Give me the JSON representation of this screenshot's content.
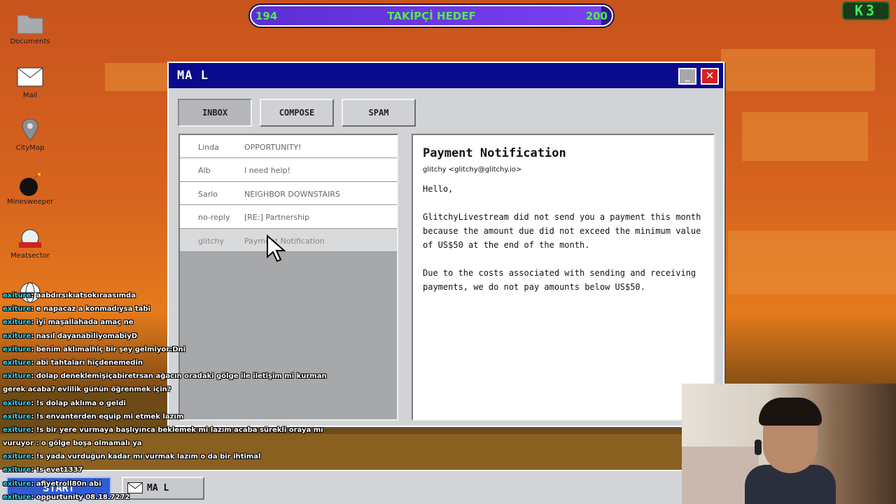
{
  "goal_bar": {
    "current": "194",
    "label": "TAKİPÇİ HEDEF",
    "target": "200",
    "progress": 0.97
  },
  "corner_badge": "K3",
  "desktop_icons": [
    {
      "label": "Documents",
      "icon": "folder-icon"
    },
    {
      "label": "Mail",
      "icon": "envelope-icon"
    },
    {
      "label": "CityMap",
      "icon": "map-pin-icon"
    },
    {
      "label": "Minesweeper",
      "icon": "bomb-icon"
    },
    {
      "label": "Meatsector",
      "icon": "meat-slicer-icon"
    },
    {
      "label": "",
      "icon": "globe-icon"
    }
  ],
  "window": {
    "title": "MA L",
    "minimize": "_",
    "close": "✕"
  },
  "tabs": [
    {
      "label": "INBOX",
      "active": true
    },
    {
      "label": "COMPOSE",
      "active": false
    },
    {
      "label": "SPAM",
      "active": false
    }
  ],
  "emails": [
    {
      "sender": "Linda",
      "subject": "OPPORTUNITY!"
    },
    {
      "sender": "Alb",
      "subject": "I need help!"
    },
    {
      "sender": "Sarlo",
      "subject": "NEIGHBOR DOWNSTAIRS"
    },
    {
      "sender": "no-reply",
      "subject": "[RE:] Partnership"
    },
    {
      "sender": "glitchy",
      "subject": "Payment Notification",
      "selected": true
    }
  ],
  "message": {
    "subject": "Payment Notification",
    "from": "glitchy <glitchy@glitchy.io>",
    "greeting": "Hello,",
    "paragraph1": "GlitchyLivestream did not send you a payment this month because the amount due did not exceed the minimum value of US$50 at the end of the month.",
    "paragraph2": "Due to the costs associated with sending and receiving payments, we do not pay amounts below US$50."
  },
  "taskbar": {
    "start": "START",
    "mail_task": "MA L"
  },
  "chat": [
    {
      "user": "exiture",
      "text": ": aabdırsıkıatsokıraasımda"
    },
    {
      "user": "exiture",
      "text": ": e napacaz a konmadıysa tabi"
    },
    {
      "user": "exiture",
      "text": ": iyi maşallahada amaç ne"
    },
    {
      "user": "exiture",
      "text": ": nasıl dayanabiliyomabiyD"
    },
    {
      "user": "exiture",
      "text": ": benim aklımaihiç bir şey gelmiyor:Dni"
    },
    {
      "user": "exiture",
      "text": ": abi tahtaları hiçdenemedin"
    },
    {
      "user": "exiture",
      "text": ": dolap deneklemişiçabiretrsan ağacın oradaki gölge ile iletişim mi kurman"
    },
    {
      "user": "",
      "text": "gerek acaba? evlilik günün öğrenmek için?"
    },
    {
      "user": "exiture",
      "text": ": !s dolap aklıma o geldi"
    },
    {
      "user": "exiture",
      "text": ": !s envanterden equip mi etmek lazım"
    },
    {
      "user": "exiture",
      "text": ": !s bir yere vurmaya başlıyınca beklemek mi lazım acaba sürekli oraya mı"
    },
    {
      "user": "",
      "text": "vuruyor : o gölge boşa olmamalı ya"
    },
    {
      "user": "exiture",
      "text": ": !s yada vurduğun kadar mı vurmak lazım o da bir ihtimal"
    },
    {
      "user": "exiture",
      "text": ": !s evet1337"
    },
    {
      "user": "exiture",
      "text": ": afiyetroll80n abi"
    },
    {
      "user": "exiture",
      "text": ": oppurtunity 08.18.7272"
    }
  ],
  "colors": {
    "titlebar": "#0a0a8c",
    "close": "#d92020",
    "start": "#2f5bd6",
    "chat_user": "#3ad1e8",
    "goal_text": "#4cf04c"
  }
}
